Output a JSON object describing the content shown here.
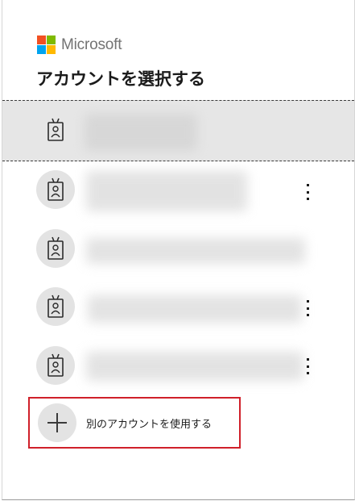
{
  "header": {
    "brand": "Microsoft",
    "title": "アカウントを選択する",
    "logo_colors": [
      "#f25022",
      "#7fba00",
      "#00a4ef",
      "#ffb900"
    ]
  },
  "accounts": [
    {
      "id": "",
      "selected": true,
      "avatar_icon": "id-badge-icon"
    },
    {
      "id": "",
      "selected": false,
      "avatar_icon": "id-badge-icon"
    },
    {
      "id": "",
      "selected": false,
      "avatar_icon": "id-badge-icon"
    },
    {
      "id": "",
      "selected": false,
      "avatar_icon": "id-badge-icon"
    },
    {
      "id": "",
      "selected": false,
      "avatar_icon": "id-badge-icon"
    }
  ],
  "add_account": {
    "label": "別のアカウントを使用する",
    "icon": "plus-icon",
    "highlight_color": "#d0202a"
  },
  "more_options_icon": "more-vertical-icon"
}
